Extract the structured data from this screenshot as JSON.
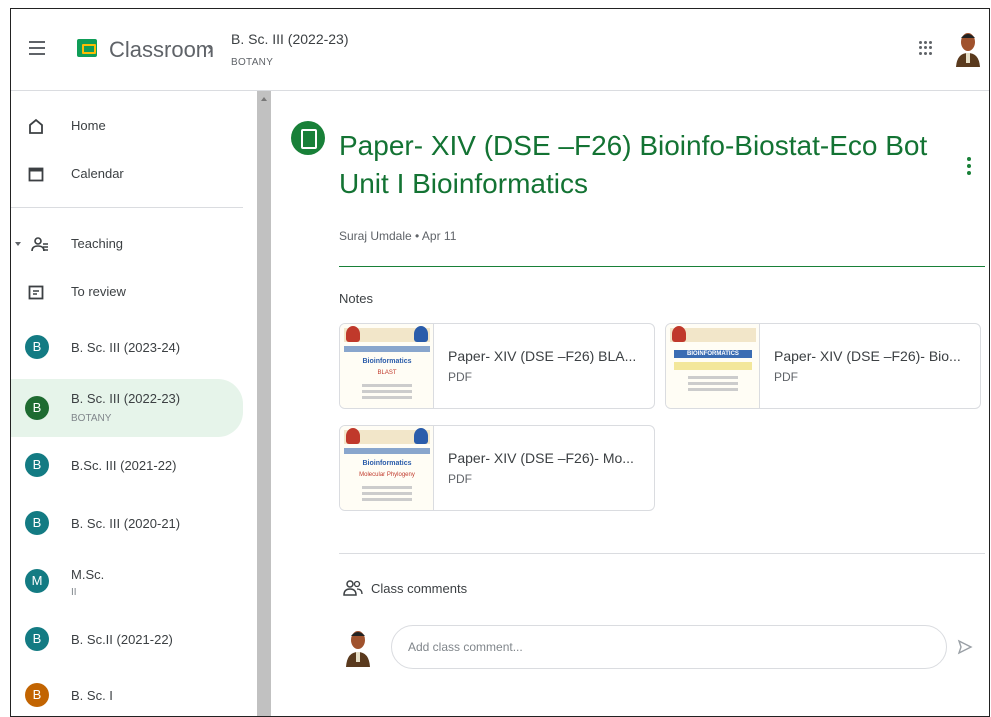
{
  "header": {
    "app_name": "Classroom",
    "breadcrumb_sep": "›",
    "class_title": "B. Sc. III (2022-23)",
    "class_section": "BOTANY"
  },
  "sidebar": {
    "home": "Home",
    "calendar": "Calendar",
    "teaching": "Teaching",
    "to_review": "To review",
    "classes": [
      {
        "initial": "B",
        "name": "B. Sc. III (2023-24)",
        "sub": "",
        "color": "#137b83"
      },
      {
        "initial": "B",
        "name": "B. Sc. III (2022-23)",
        "sub": "BOTANY",
        "color": "#1e6b31"
      },
      {
        "initial": "B",
        "name": "B.Sc. III (2021-22)",
        "sub": "",
        "color": "#137b83"
      },
      {
        "initial": "B",
        "name": "B. Sc. III (2020-21)",
        "sub": "",
        "color": "#137b83"
      },
      {
        "initial": "M",
        "name": "M.Sc.",
        "sub": "II",
        "color": "#137b83"
      },
      {
        "initial": "B",
        "name": "B. Sc.II (2021-22)",
        "sub": "",
        "color": "#137b83"
      },
      {
        "initial": "B",
        "name": "B. Sc. I",
        "sub": "",
        "color": "#c26401"
      }
    ]
  },
  "post": {
    "title": "Paper- XIV (DSE –F26) Bioinfo-Biostat-Eco Bot Unit I Bioinformatics",
    "meta": "Suraj Umdale • Apr 11",
    "notes_label": "Notes"
  },
  "attachments": [
    {
      "name": "Paper- XIV (DSE –F26) BLA...",
      "type": "PDF",
      "thumb_title": "Bioinformatics",
      "thumb_sub": "BLAST"
    },
    {
      "name": "Paper- XIV (DSE –F26)- Bio...",
      "type": "PDF",
      "thumb_title": "BIOINFORMATICS",
      "thumb_sub": ""
    },
    {
      "name": "Paper- XIV (DSE –F26)- Mo...",
      "type": "PDF",
      "thumb_title": "Bioinformatics",
      "thumb_sub": "Molecular Phylogeny"
    }
  ],
  "comments": {
    "label": "Class comments",
    "placeholder": "Add class comment..."
  },
  "colors": {
    "accent": "#188038",
    "active_bg": "#e6f4ea"
  }
}
